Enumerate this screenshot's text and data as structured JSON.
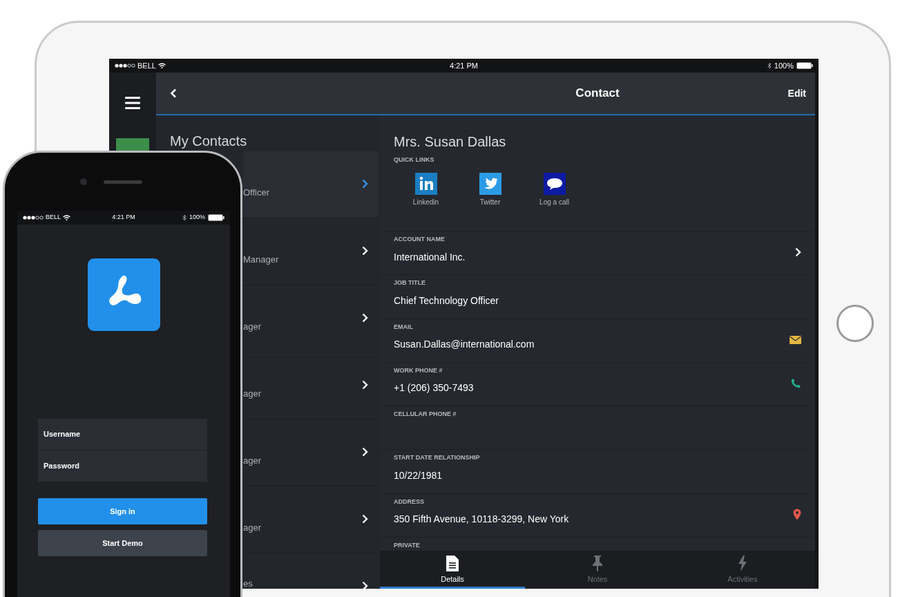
{
  "tablet": {
    "status_bar": {
      "carrier": "BELL",
      "time": "4:21 PM",
      "battery": "100%"
    },
    "nav_bar": {
      "title": "Contact",
      "action": "Edit"
    },
    "contact_list": {
      "title": "My Contacts",
      "rows": [
        {
          "text": "Officer",
          "selected": true
        },
        {
          "text": "Manager",
          "selected": false
        },
        {
          "text": "ager",
          "selected": false
        },
        {
          "text": "ager",
          "selected": false
        },
        {
          "text": "ager",
          "selected": false
        },
        {
          "text": "ager",
          "selected": false
        },
        {
          "text": "es",
          "selected": false
        }
      ]
    },
    "contact": {
      "name": "Mrs. Susan Dallas",
      "quick_links": {
        "heading": "QUICK LINKS",
        "items": [
          {
            "kind": "linkedin",
            "label": "Linkedin"
          },
          {
            "kind": "twitter",
            "label": "Twitter"
          },
          {
            "kind": "chat",
            "label": "Log a call"
          }
        ]
      },
      "fields": [
        {
          "label": "ACCOUNT NAME",
          "value": "International Inc.",
          "kind": "chevron"
        },
        {
          "label": "JOB TITLE",
          "value": "Chief Technology Officer"
        },
        {
          "label": "EMAIL",
          "value": "Susan.Dallas@international.com",
          "kind": "email"
        },
        {
          "label": "WORK PHONE #",
          "value": "+1 (206) 350-7493",
          "kind": "phone"
        },
        {
          "label": "CELLULAR PHONE #"
        },
        {
          "label": "START DATE RELATIONSHIP",
          "value": "10/22/1981"
        },
        {
          "label": "ADDRESS",
          "value": "350 Fifth Avenue, 10118-3299, New York",
          "kind": "location"
        },
        {
          "label": "PRIVATE"
        }
      ]
    },
    "tabs": [
      {
        "label": "Details",
        "kind": "document",
        "selected": true
      },
      {
        "label": "Notes",
        "kind": "pin",
        "selected": false
      },
      {
        "label": "Activities",
        "kind": "bolt",
        "selected": false
      }
    ]
  },
  "phone": {
    "status_bar": {
      "carrier": "BELL",
      "time": "4:21 PM",
      "battery": "100%"
    },
    "login": {
      "fields": [
        {
          "placeholder": "Username"
        },
        {
          "placeholder": "Password"
        }
      ],
      "buttons": [
        {
          "label": "Sign in",
          "kind": "primary"
        },
        {
          "label": "Start Demo",
          "kind": "secondary"
        }
      ]
    }
  }
}
